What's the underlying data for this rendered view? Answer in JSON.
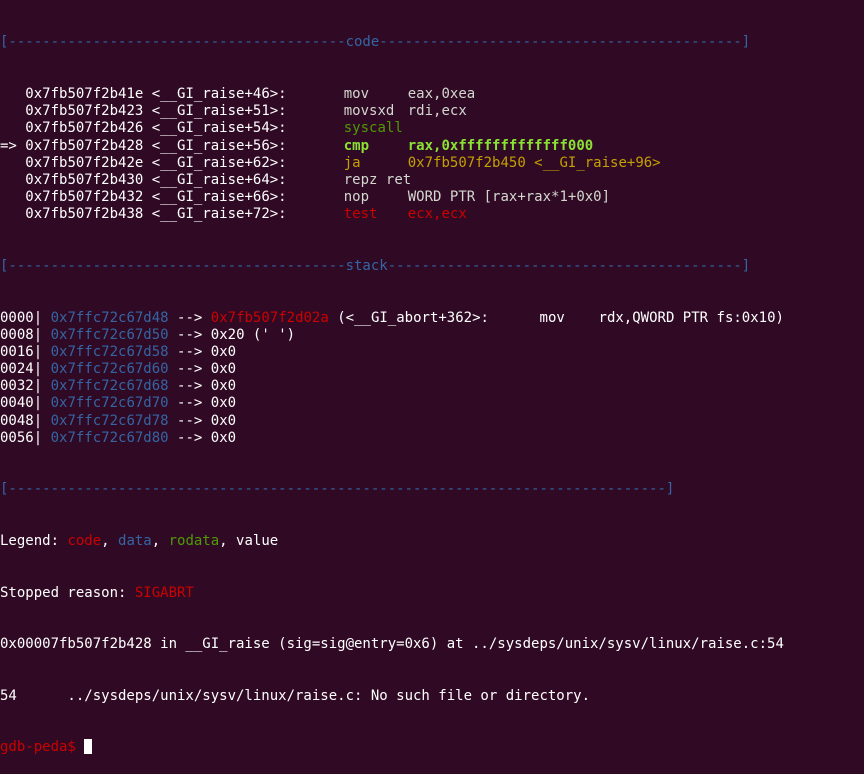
{
  "colors": {
    "background": "#300a24",
    "separator": "#3465a4",
    "code": "#cc0000",
    "data": "#3465a4",
    "rodata": "#4e9a06",
    "value": "#ffffff",
    "current_instruction": "#8ae234",
    "jump": "#c4a000"
  },
  "code_section": {
    "separator_left": "[----------------------------------------",
    "separator_title": "code",
    "separator_right": "-------------------------------------------]",
    "rows": [
      {
        "marker": "  ",
        "addr": "0x7fb507f2b41e",
        "sym": "<__GI_raise+46>:",
        "mnem": "mov",
        "ops": "eax,0xea",
        "style": "normal"
      },
      {
        "marker": "  ",
        "addr": "0x7fb507f2b423",
        "sym": "<__GI_raise+51>:",
        "mnem": "movsxd",
        "ops": "rdi,ecx",
        "style": "normal"
      },
      {
        "marker": "  ",
        "addr": "0x7fb507f2b426",
        "sym": "<__GI_raise+54>:",
        "mnem": "syscall",
        "ops": "",
        "style": "syscall"
      },
      {
        "marker": "=>",
        "addr": "0x7fb507f2b428",
        "sym": "<__GI_raise+56>:",
        "mnem": "cmp",
        "ops": "rax,0xfffffffffffff000",
        "style": "current"
      },
      {
        "marker": "  ",
        "addr": "0x7fb507f2b42e",
        "sym": "<__GI_raise+62>:",
        "mnem": "ja",
        "ops": "0x7fb507f2b450 <__GI_raise+96>",
        "style": "jump"
      },
      {
        "marker": "  ",
        "addr": "0x7fb507f2b430",
        "sym": "<__GI_raise+64>:",
        "mnem": "repz ret",
        "ops": "",
        "style": "normal"
      },
      {
        "marker": "  ",
        "addr": "0x7fb507f2b432",
        "sym": "<__GI_raise+66>:",
        "mnem": "nop",
        "ops": "WORD PTR [rax+rax*1+0x0]",
        "style": "normal"
      },
      {
        "marker": "  ",
        "addr": "0x7fb507f2b438",
        "sym": "<__GI_raise+72>:",
        "mnem": "test",
        "ops": "ecx,ecx",
        "style": "test"
      }
    ]
  },
  "stack_section": {
    "separator_left": "[----------------------------------------",
    "separator_title": "stack",
    "separator_right": "------------------------------------------]",
    "rows": [
      {
        "offset": "0000|",
        "addr": "0x7ffc72c67d48",
        "arrow": "-->",
        "value": "0x7fb507f2d02a",
        "value_style": "code",
        "rest": " (<__GI_abort+362>:      mov    rdx,QWORD PTR fs:0x10)"
      },
      {
        "offset": "0008|",
        "addr": "0x7ffc72c67d50",
        "arrow": "-->",
        "value": "0x20 (' ')",
        "value_style": "value",
        "rest": ""
      },
      {
        "offset": "0016|",
        "addr": "0x7ffc72c67d58",
        "arrow": "-->",
        "value": "0x0",
        "value_style": "value",
        "rest": ""
      },
      {
        "offset": "0024|",
        "addr": "0x7ffc72c67d60",
        "arrow": "-->",
        "value": "0x0",
        "value_style": "value",
        "rest": ""
      },
      {
        "offset": "0032|",
        "addr": "0x7ffc72c67d68",
        "arrow": "-->",
        "value": "0x0",
        "value_style": "value",
        "rest": ""
      },
      {
        "offset": "0040|",
        "addr": "0x7ffc72c67d70",
        "arrow": "-->",
        "value": "0x0",
        "value_style": "value",
        "rest": ""
      },
      {
        "offset": "0048|",
        "addr": "0x7ffc72c67d78",
        "arrow": "-->",
        "value": "0x0",
        "value_style": "value",
        "rest": ""
      },
      {
        "offset": "0056|",
        "addr": "0x7ffc72c67d80",
        "arrow": "-->",
        "value": "0x0",
        "value_style": "value",
        "rest": ""
      }
    ]
  },
  "bottom_separator": "[------------------------------------------------------------------------------]",
  "legend": {
    "label": "Legend: ",
    "code": "code",
    "comma1": ", ",
    "data": "data",
    "comma2": ", ",
    "rodata": "rodata",
    "comma3": ", ",
    "value": "value"
  },
  "stopped": {
    "label": "Stopped reason: ",
    "reason": "SIGABRT"
  },
  "frame_line": "0x00007fb507f2b428 in __GI_raise (sig=sig@entry=0x6) at ../sysdeps/unix/sysv/linux/raise.c:54",
  "source_line": "54      ../sysdeps/unix/sysv/linux/raise.c: No such file or directory.",
  "prompt": "gdb-peda$ "
}
